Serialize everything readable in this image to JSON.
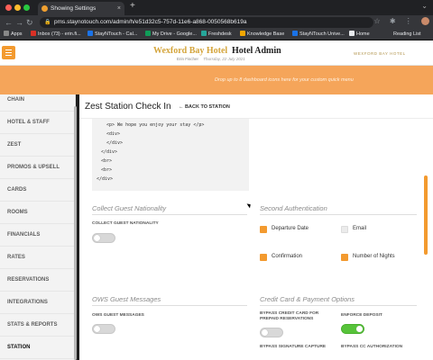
{
  "browser": {
    "tab_title": "Showing Settings",
    "tab_close": "×",
    "new_tab": "+",
    "window_controls": "⌄",
    "nav": {
      "back": "←",
      "forward": "→",
      "reload": "↻"
    },
    "lock": "🔒",
    "url": "pms.staynotouch.com/admin/h/e51d32c5-757d-11e6-a868-0050568b619a",
    "toolbar_icons": "☆ ✱ ⋮",
    "bookmarks": [
      {
        "label": "Apps",
        "color": "#888"
      },
      {
        "label": "Inbox (73) - erin.fi...",
        "color": "#d93025"
      },
      {
        "label": "StayNTouch - Cal...",
        "color": "#1a73e8"
      },
      {
        "label": "My Drive - Google...",
        "color": "#0f9d58"
      },
      {
        "label": "Freshdesk",
        "color": "#26a69a"
      },
      {
        "label": "Knowledge Base",
        "color": "#f2a600"
      },
      {
        "label": "StayNTouch Unive...",
        "color": "#1a73e8"
      },
      {
        "label": "Home",
        "color": "#e8eaed"
      }
    ],
    "reading_list": "Reading List"
  },
  "header": {
    "hotel_name": "Wexford Bay Hotel",
    "admin_label": "Hotel Admin",
    "user": "Erin Fischer",
    "date": "Thursday, 22 July 2021",
    "logo_text": "WEXFORD BAY HOTEL"
  },
  "banner": {
    "message": "Drop up to 8 dashboard icons here for your custom quick menu"
  },
  "sidebar": {
    "items": [
      {
        "label": "CHAIN"
      },
      {
        "label": "HOTEL & STAFF"
      },
      {
        "label": "ZEST"
      },
      {
        "label": "PROMOS & UPSELL"
      },
      {
        "label": "CARDS"
      },
      {
        "label": "ROOMS"
      },
      {
        "label": "FINANCIALS"
      },
      {
        "label": "RATES"
      },
      {
        "label": "RESERVATIONS"
      },
      {
        "label": "INTEGRATIONS"
      },
      {
        "label": "STATS & REPORTS"
      },
      {
        "label": "STATION"
      }
    ]
  },
  "page": {
    "title": "Zest Station Check In",
    "back_label": "BACK TO STATION",
    "back_icon": "←",
    "code_lines": [
      "<p> We hope you enjoy your stay </p>",
      "<div>",
      "</div>",
      "</div>",
      "<br>",
      "<br>",
      "</div>"
    ],
    "collect_nationality": {
      "title": "Collect Guest Nationality",
      "field_label": "COLLECT GUEST NATIONALITY",
      "enabled": false
    },
    "second_auth": {
      "title": "Second Authentication",
      "options": [
        {
          "label": "Departure Date",
          "checked": true
        },
        {
          "label": "Email",
          "checked": false
        },
        {
          "label": "Confirmation",
          "checked": true
        },
        {
          "label": "Number of Nights",
          "checked": true
        }
      ]
    },
    "ows_messages": {
      "title": "OWS Guest Messages",
      "field_label": "OWS GUEST MESSAGES",
      "enabled": false
    },
    "credit_card": {
      "title": "Credit Card & Payment Options",
      "fields": [
        {
          "label": "BYPASS CREDIT CARD FOR PREPAID RESERVATIONS",
          "enabled": false
        },
        {
          "label": "ENFORCE DEPOSIT",
          "enabled": true
        },
        {
          "label": "BYPASS SIGNATURE CAPTURE",
          "enabled": null
        },
        {
          "label": "BYPASS CC AUTHORIZATION",
          "enabled": null
        }
      ]
    }
  },
  "colors": {
    "accent": "#f39a2f",
    "banner": "#f5a55a",
    "toggle_on": "#57c33a",
    "hotel_gold": "#d4a43a"
  }
}
